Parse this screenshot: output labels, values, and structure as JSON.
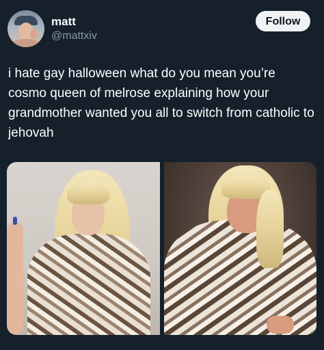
{
  "author": {
    "display_name": "matt",
    "handle": "@mattxiv",
    "avatar_icon": "profile-avatar"
  },
  "actions": {
    "follow_label": "Follow"
  },
  "tweet": {
    "text": "i hate gay halloween what do you mean you’re cosmo queen of melrose explaining how your grandmother wanted you all to switch from catholic to jehovah"
  },
  "media": [
    {
      "name": "photo-left",
      "description_icon": "photo"
    },
    {
      "name": "photo-right",
      "description_icon": "photo"
    }
  ],
  "colors": {
    "background": "#15202b",
    "text_primary": "#ffffff",
    "text_secondary": "#8899a6",
    "follow_bg": "#eff3f4",
    "follow_text": "#0f1419"
  }
}
